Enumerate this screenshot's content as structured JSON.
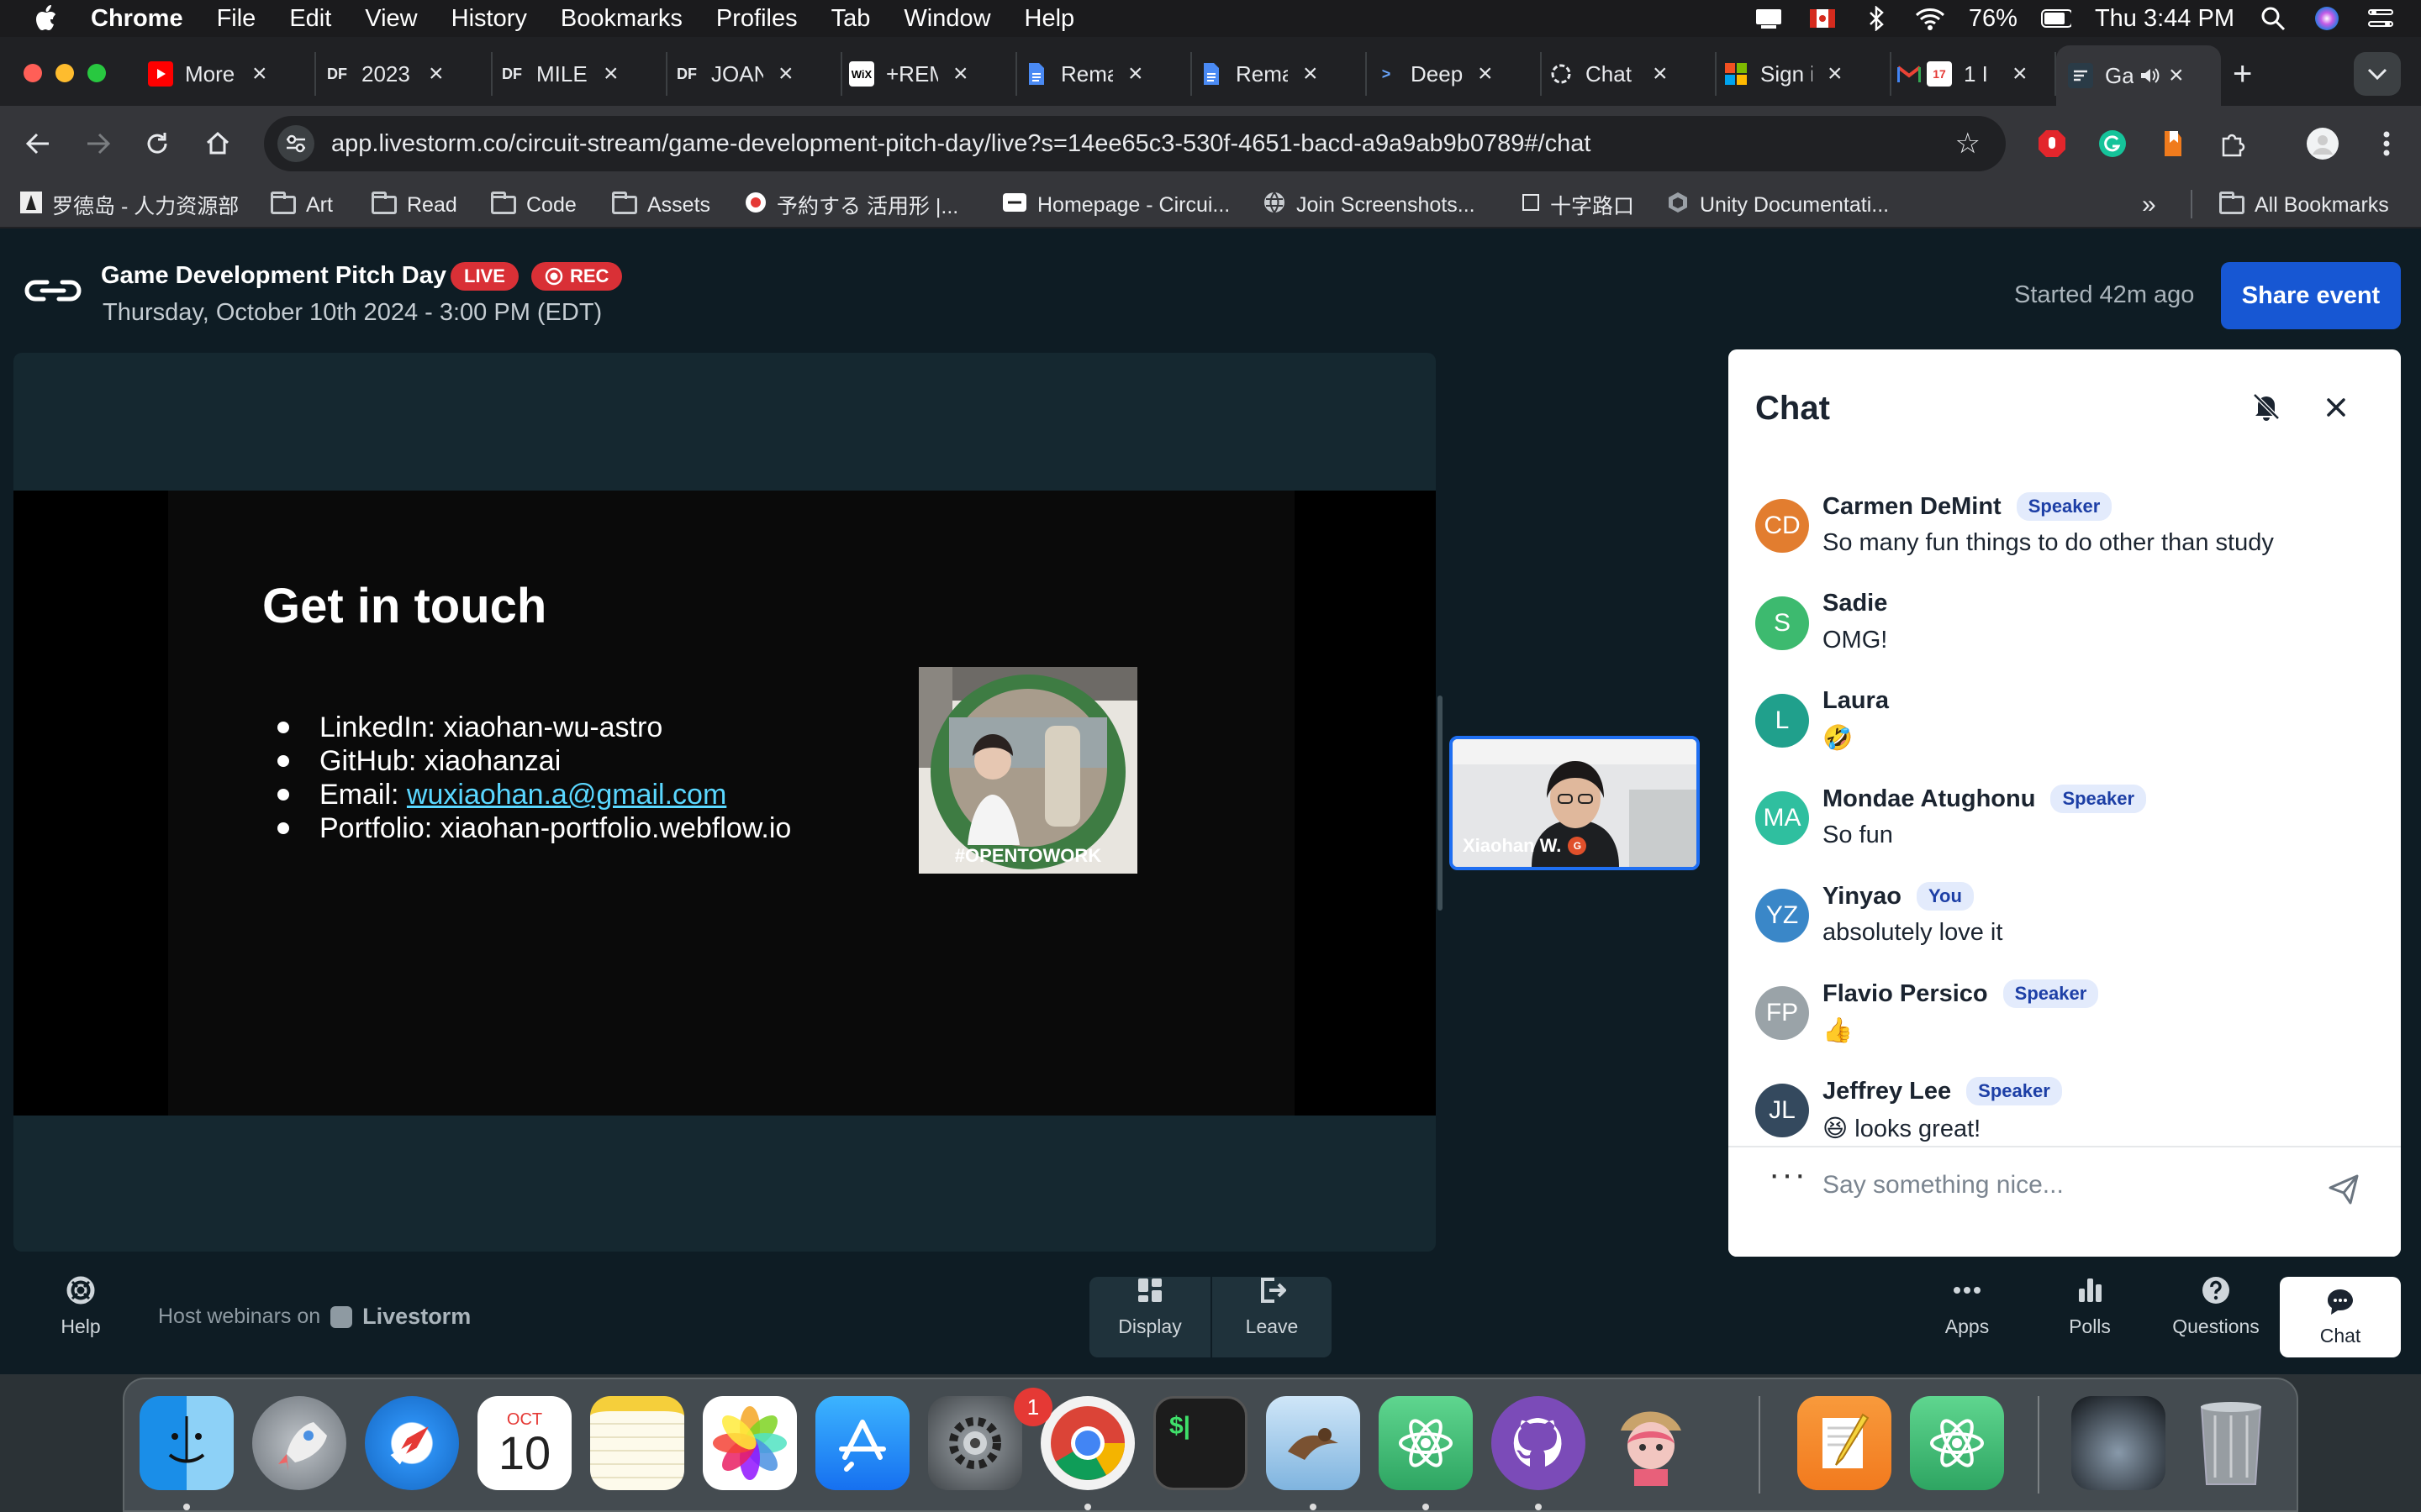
{
  "menubar": {
    "app_name": "Chrome",
    "items": [
      "File",
      "Edit",
      "View",
      "History",
      "Bookmarks",
      "Profiles",
      "Tab",
      "Window",
      "Help"
    ],
    "battery": "76%",
    "clock": "Thu 3:44 PM"
  },
  "tabs": [
    {
      "title": "More",
      "favicon": "youtube-icon"
    },
    {
      "title": "2023",
      "favicon": "DF"
    },
    {
      "title": "MILEN",
      "favicon": "DF"
    },
    {
      "title": "JOAN",
      "favicon": "DF"
    },
    {
      "title": "+REM",
      "favicon": "WiX"
    },
    {
      "title": "Rema",
      "favicon": "doc-icon"
    },
    {
      "title": "Rema",
      "favicon": "doc-icon"
    },
    {
      "title": "Deep",
      "favicon": "deepl-icon"
    },
    {
      "title": "Chat",
      "favicon": "chatgpt-icon"
    },
    {
      "title": "Sign i",
      "favicon": "microsoft-icon"
    },
    {
      "title": "1 I",
      "favicon": "gmail-icon"
    },
    {
      "title": "Ga",
      "favicon": "livestorm-icon",
      "active": true
    }
  ],
  "address_bar": {
    "url": "app.livestorm.co/circuit-stream/game-development-pitch-day/live?s=14ee65c3-530f-4651-bacd-a9a9ab9b0789#/chat"
  },
  "bookmarks": [
    "罗德岛 - 人力资源部",
    "Art",
    "Read",
    "Code",
    "Assets",
    "予約する 活用形 |...",
    "Homepage - Circui...",
    "Join Screenshots...",
    "十字路口",
    "Unity Documentati...",
    "All Bookmarks"
  ],
  "event": {
    "title": "Game Development Pitch Day",
    "live_badge": "LIVE",
    "rec_badge": "REC",
    "date": "Thursday, October 10th 2024 - 3:00 PM (EDT)",
    "started": "Started 42m ago",
    "share_label": "Share event"
  },
  "slide": {
    "title": "Get in touch",
    "items": [
      {
        "text": "LinkedIn: xiaohan-wu-astro"
      },
      {
        "text": "GitHub: xiaohanzai"
      },
      {
        "label": "Email: ",
        "link": "wuxiaohan.a@gmail.com"
      },
      {
        "text": "Portfolio: xiaohan-portfolio.webflow.io"
      }
    ],
    "photo_frame_text": "#OPENTOWORK"
  },
  "camera": {
    "name": "Xiaohan W."
  },
  "chat": {
    "title": "Chat",
    "messages": [
      {
        "initials": "CD",
        "color": "#e27d2f",
        "name": "Carmen DeMint",
        "role": "Speaker",
        "text": "So many fun things to do other than study"
      },
      {
        "initials": "S",
        "color": "#3dba6f",
        "name": "Sadie",
        "role": "",
        "text": "OMG!"
      },
      {
        "initials": "L",
        "color": "#20a08c",
        "name": "Laura",
        "role": "",
        "text": "🤣"
      },
      {
        "initials": "MA",
        "color": "#2fbf9f",
        "name": "Mondae Atughonu",
        "role": "Speaker",
        "text": "So fun"
      },
      {
        "initials": "YZ",
        "color": "#3a87c8",
        "name": "Yinyao",
        "role": "You",
        "text": "absolutely love it"
      },
      {
        "initials": "FP",
        "color": "#9aa3a8",
        "name": "Flavio Persico",
        "role": "Speaker",
        "text": "👍"
      },
      {
        "initials": "JL",
        "color": "#34495e",
        "name": "Jeffrey Lee",
        "role": "Speaker",
        "text": "😆 looks great!"
      }
    ],
    "input_placeholder": "Say something nice..."
  },
  "bottom_bar": {
    "help": "Help",
    "host_text": "Host webinars on",
    "host_brand": "Livestorm",
    "display": "Display",
    "leave": "Leave",
    "apps": "Apps",
    "polls": "Polls",
    "questions": "Questions",
    "chat": "Chat"
  },
  "dock": {
    "calendar_month": "OCT",
    "calendar_day": "10",
    "settings_badge": "1",
    "apps": [
      "finder",
      "launchpad",
      "safari",
      "calendar",
      "notes",
      "photos",
      "app-store",
      "system-settings",
      "chrome",
      "terminal",
      "preview",
      "atom",
      "github-desktop",
      "character",
      "pages",
      "atom",
      "screenshot",
      "trash"
    ]
  }
}
